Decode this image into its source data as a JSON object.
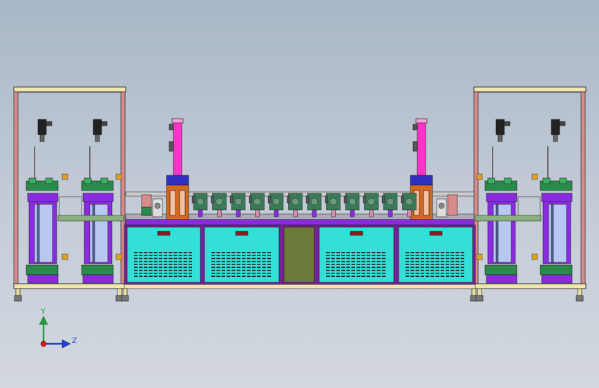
{
  "viewport": {
    "background_top": "#a9b7c8",
    "background_bottom": "#d3d8df"
  },
  "triad": {
    "y_label": "Y",
    "z_label": "Z",
    "y_color": "#20a040",
    "z_color": "#2040d0",
    "origin_color": "#d02020"
  },
  "model": {
    "frame_color": "#d98a8a",
    "frame_top_color": "#f0e6b0",
    "panel_color": "#33e0d8",
    "panel_border": "#7a1f9a",
    "center_panel_color": "#6b7a3a",
    "column_color": "#ff33cc",
    "roller_purple": "#8a2be2",
    "roller_green": "#2a8a4a",
    "orange_block": "#d2691e",
    "vent_color": "#222222"
  }
}
